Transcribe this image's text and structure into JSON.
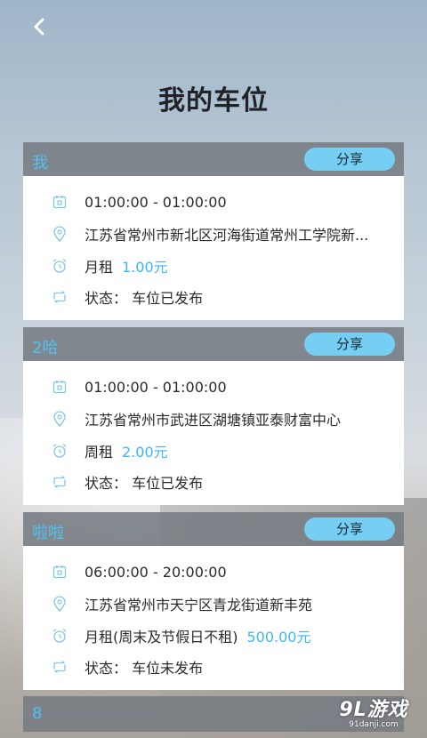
{
  "header": {
    "title": "我的车位"
  },
  "accent_color": "#76cef3",
  "name_color": "#4fc1f2",
  "cards": [
    {
      "name": "我",
      "share_label": "分享",
      "time": "01:00:00 - 01:00:00",
      "address": "江苏省常州市新北区河海街道常州工学院新...",
      "rent_type": "月租",
      "price": "1.00元",
      "status": "状态：  车位已发布"
    },
    {
      "name": "2哈",
      "share_label": "分享",
      "time": "01:00:00 - 01:00:00",
      "address": "江苏省常州市武进区湖塘镇亚泰财富中心",
      "rent_type": "周租",
      "price": "2.00元",
      "status": "状态：  车位已发布"
    },
    {
      "name": "啦啦",
      "share_label": "分享",
      "time": "06:00:00 - 20:00:00",
      "address": "江苏省常州市天宁区青龙街道新丰苑",
      "rent_type": "月租(周末及节假日不租)",
      "price": "500.00元",
      "status": "状态：  车位未发布"
    }
  ],
  "partial_card": {
    "name": "8"
  },
  "watermark": {
    "main": "9L游戏",
    "sub": "91danji.com"
  }
}
